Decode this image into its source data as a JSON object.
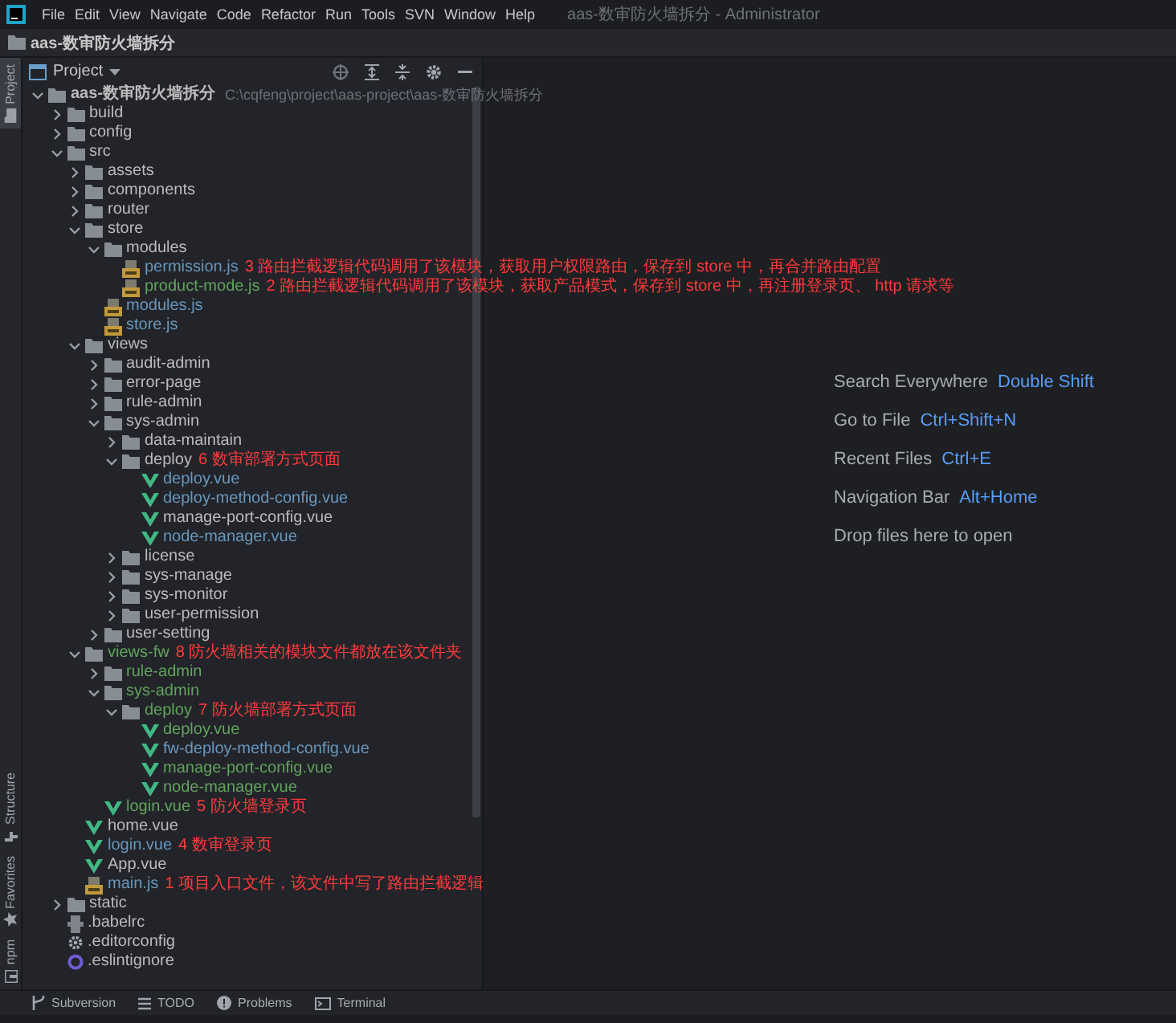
{
  "menu_bar": {
    "items": [
      "File",
      "Edit",
      "View",
      "Navigate",
      "Code",
      "Refactor",
      "Run",
      "Tools",
      "SVN",
      "Window",
      "Help"
    ],
    "title": "aas-数审防火墙拆分 - Administrator"
  },
  "nav_bar": {
    "crumb": "aas-数审防火墙拆分"
  },
  "left_stripe": {
    "top": [
      {
        "label": "Project",
        "selected": true
      }
    ],
    "bottom": [
      {
        "label": "Structure",
        "kind": "structure",
        "selected": false
      },
      {
        "label": "Favorites",
        "kind": "favorites",
        "selected": false
      },
      {
        "label": "npm",
        "kind": "npm",
        "selected": false
      }
    ]
  },
  "project_panel": {
    "title": "Project",
    "tree": [
      {
        "name": "aas-数审防火墙拆分",
        "kind": "folder",
        "color": "#bbbbbb",
        "bold": true,
        "path": "C:\\cqfeng\\project\\aas-project\\aas-数审防火墙拆分",
        "expanded": true,
        "children": [
          {
            "name": "build",
            "kind": "folder",
            "color": "#bbbbbb",
            "expanded": false
          },
          {
            "name": "config",
            "kind": "folder",
            "color": "#bbbbbb",
            "expanded": false
          },
          {
            "name": "src",
            "kind": "folder",
            "color": "#bbbbbb",
            "expanded": true,
            "children": [
              {
                "name": "assets",
                "kind": "folder",
                "color": "#bbbbbb",
                "expanded": false
              },
              {
                "name": "components",
                "kind": "folder",
                "color": "#bbbbbb",
                "expanded": false
              },
              {
                "name": "router",
                "kind": "folder",
                "color": "#bbbbbb",
                "expanded": false
              },
              {
                "name": "store",
                "kind": "folder",
                "color": "#bbbbbb",
                "expanded": true,
                "children": [
                  {
                    "name": "modules",
                    "kind": "folder",
                    "color": "#bbbbbb",
                    "expanded": true,
                    "children": [
                      {
                        "name": "permission.js",
                        "kind": "js",
                        "color": "#6897bb",
                        "note": "3 路由拦截逻辑代码调用了该模块，获取用户权限路由，保存到 store 中，再合并路由配置"
                      },
                      {
                        "name": "product-mode.js",
                        "kind": "js",
                        "color": "#62a35c",
                        "note": "2 路由拦截逻辑代码调用了该模块，获取产品模式，保存到 store 中，再注册登录页、 http 请求等"
                      }
                    ]
                  },
                  {
                    "name": "modules.js",
                    "kind": "js",
                    "color": "#6897bb"
                  },
                  {
                    "name": "store.js",
                    "kind": "js",
                    "color": "#6897bb"
                  }
                ]
              },
              {
                "name": "views",
                "kind": "folder",
                "color": "#bbbbbb",
                "expanded": true,
                "children": [
                  {
                    "name": "audit-admin",
                    "kind": "folder",
                    "color": "#bbbbbb",
                    "expanded": false
                  },
                  {
                    "name": "error-page",
                    "kind": "folder",
                    "color": "#bbbbbb",
                    "expanded": false
                  },
                  {
                    "name": "rule-admin",
                    "kind": "folder",
                    "color": "#bbbbbb",
                    "expanded": false
                  },
                  {
                    "name": "sys-admin",
                    "kind": "folder",
                    "color": "#bbbbbb",
                    "expanded": true,
                    "children": [
                      {
                        "name": "data-maintain",
                        "kind": "folder",
                        "color": "#bbbbbb",
                        "expanded": false
                      },
                      {
                        "name": "deploy",
                        "kind": "folder",
                        "color": "#bbbbbb",
                        "expanded": true,
                        "note": "6 数审部署方式页面",
                        "children": [
                          {
                            "name": "deploy.vue",
                            "kind": "vue",
                            "color": "#6897bb"
                          },
                          {
                            "name": "deploy-method-config.vue",
                            "kind": "vue",
                            "color": "#6897bb"
                          },
                          {
                            "name": "manage-port-config.vue",
                            "kind": "vue",
                            "color": "#bbbbbb"
                          },
                          {
                            "name": "node-manager.vue",
                            "kind": "vue",
                            "color": "#6897bb"
                          }
                        ]
                      },
                      {
                        "name": "license",
                        "kind": "folder",
                        "color": "#bbbbbb",
                        "expanded": false
                      },
                      {
                        "name": "sys-manage",
                        "kind": "folder",
                        "color": "#bbbbbb",
                        "expanded": false
                      },
                      {
                        "name": "sys-monitor",
                        "kind": "folder",
                        "color": "#bbbbbb",
                        "expanded": false
                      },
                      {
                        "name": "user-permission",
                        "kind": "folder",
                        "color": "#bbbbbb",
                        "expanded": false
                      }
                    ]
                  },
                  {
                    "name": "user-setting",
                    "kind": "folder",
                    "color": "#bbbbbb",
                    "expanded": false
                  }
                ]
              },
              {
                "name": "views-fw",
                "kind": "folder",
                "color": "#62a35c",
                "expanded": true,
                "note": "8 防火墙相关的模块文件都放在该文件夹",
                "children": [
                  {
                    "name": "rule-admin",
                    "kind": "folder",
                    "color": "#62a35c",
                    "expanded": false
                  },
                  {
                    "name": "sys-admin",
                    "kind": "folder",
                    "color": "#62a35c",
                    "expanded": true,
                    "children": [
                      {
                        "name": "deploy",
                        "kind": "folder",
                        "color": "#62a35c",
                        "expanded": true,
                        "note": "7 防火墙部署方式页面",
                        "children": [
                          {
                            "name": "deploy.vue",
                            "kind": "vue",
                            "color": "#62a35c"
                          },
                          {
                            "name": "fw-deploy-method-config.vue",
                            "kind": "vue",
                            "color": "#6897bb"
                          },
                          {
                            "name": "manage-port-config.vue",
                            "kind": "vue",
                            "color": "#62a35c"
                          },
                          {
                            "name": "node-manager.vue",
                            "kind": "vue",
                            "color": "#62a35c"
                          }
                        ]
                      }
                    ]
                  },
                  {
                    "name": "login.vue",
                    "kind": "vue",
                    "color": "#62a35c",
                    "note": "5 防火墙登录页"
                  }
                ]
              },
              {
                "name": "home.vue",
                "kind": "vue",
                "color": "#bbbbbb"
              },
              {
                "name": "login.vue",
                "kind": "vue",
                "color": "#6897bb",
                "note": "4 数审登录页"
              },
              {
                "name": "App.vue",
                "kind": "vue",
                "color": "#bbbbbb"
              },
              {
                "name": "main.js",
                "kind": "js",
                "color": "#6897bb",
                "note": "1 项目入口文件，该文件中写了路由拦截逻辑"
              }
            ]
          },
          {
            "name": "static",
            "kind": "folder",
            "color": "#bbbbbb",
            "expanded": false
          },
          {
            "name": ".babelrc",
            "kind": "babel",
            "color": "#bbbbbb"
          },
          {
            "name": ".editorconfig",
            "kind": "editorconfig",
            "color": "#bbbbbb"
          },
          {
            "name": ".eslintignore",
            "kind": "ignore",
            "color": "#bbbbbb"
          }
        ]
      }
    ]
  },
  "editor_hints": [
    {
      "label": "Search Everywhere",
      "shortcut": "Double Shift"
    },
    {
      "label": "Go to File",
      "shortcut": "Ctrl+Shift+N"
    },
    {
      "label": "Recent Files",
      "shortcut": "Ctrl+E"
    },
    {
      "label": "Navigation Bar",
      "shortcut": "Alt+Home"
    },
    {
      "label": "Drop files here to open"
    }
  ],
  "bottom_tools": [
    {
      "label": "Subversion",
      "kind": "vcs"
    },
    {
      "label": "TODO",
      "kind": "todo"
    },
    {
      "label": "Problems",
      "kind": "problems"
    },
    {
      "label": "Terminal",
      "kind": "terminal"
    }
  ]
}
